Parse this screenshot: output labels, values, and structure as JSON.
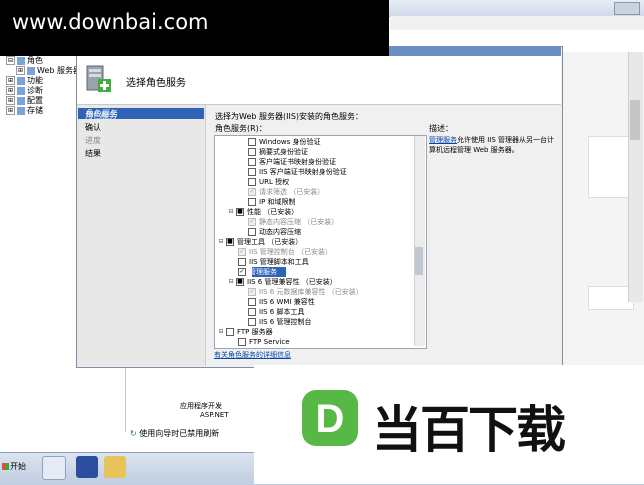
{
  "watermark": {
    "text": "www.downbai.com"
  },
  "brand": {
    "text": "当百下载",
    "logo_letter": "D",
    "colors": {
      "green": "#57b846",
      "dark": "#111111"
    }
  },
  "background": {
    "tree": [
      {
        "label": "角色",
        "expand": "⊟"
      },
      {
        "label": "Web 服务器",
        "expand": "⊞"
      },
      {
        "label": "功能",
        "expand": "⊞"
      },
      {
        "label": "诊断",
        "expand": "⊞"
      },
      {
        "label": "配置",
        "expand": "⊞"
      },
      {
        "label": "存储",
        "expand": "⊞"
      }
    ],
    "bottom_lines": [
      "应用程序开发",
      "ASP.NET"
    ],
    "status": "使用向导时已禁用刷新"
  },
  "taskbar": {
    "start_label": "开始"
  },
  "dialog": {
    "header_title": "选择角色服务",
    "steps": [
      {
        "label": "角色服务",
        "selected": true
      },
      {
        "label": "确认",
        "selected": false
      },
      {
        "label": "进度",
        "selected": false,
        "dim": true
      },
      {
        "label": "结果",
        "selected": false
      }
    ],
    "intro": "选择为Web 服务器(IIS)安装的角色服务：",
    "roles_label": "角色服务(R)：",
    "items": [
      {
        "label": "Windows 身份验证",
        "indent": 2,
        "check": "",
        "dim": false
      },
      {
        "label": "摘要式身份验证",
        "indent": 2,
        "check": "",
        "dim": false
      },
      {
        "label": "客户端证书映射身份验证",
        "indent": 2,
        "check": "",
        "dim": false
      },
      {
        "label": "IIS 客户端证书映射身份验证",
        "indent": 2,
        "check": "",
        "dim": false
      },
      {
        "label": "URL 授权",
        "indent": 2,
        "check": "",
        "dim": false
      },
      {
        "label": "请求筛选  （已安装）",
        "indent": 2,
        "check": "✓",
        "dim": true
      },
      {
        "label": "IP 和域限制",
        "indent": 2,
        "check": "",
        "dim": false
      },
      {
        "label": "性能  （已安装）",
        "indent": 1,
        "check": "■",
        "dim": false,
        "toggle": "⊟"
      },
      {
        "label": "静态内容压缩  （已安装）",
        "indent": 2,
        "check": "✓",
        "dim": true
      },
      {
        "label": "动态内容压缩",
        "indent": 2,
        "check": "",
        "dim": false
      },
      {
        "label": "管理工具  （已安装）",
        "indent": 0,
        "check": "■",
        "dim": false,
        "toggle": "⊟"
      },
      {
        "label": "IIS 管理控制台  （已安装）",
        "indent": 1,
        "check": "✓",
        "dim": true
      },
      {
        "label": "IIS 管理脚本和工具",
        "indent": 1,
        "check": "",
        "dim": false
      },
      {
        "label": "管理服务",
        "indent": 1,
        "check": "✓",
        "dim": false,
        "selected": true
      },
      {
        "label": "IIS 6 管理兼容性  （已安装）",
        "indent": 1,
        "check": "■",
        "dim": false,
        "toggle": "⊟"
      },
      {
        "label": "IIS 6 元数据库兼容性  （已安装）",
        "indent": 2,
        "check": "✓",
        "dim": true
      },
      {
        "label": "IIS 6 WMI 兼容性",
        "indent": 2,
        "check": "",
        "dim": false
      },
      {
        "label": "IIS 6 脚本工具",
        "indent": 2,
        "check": "",
        "dim": false
      },
      {
        "label": "IIS 6 管理控制台",
        "indent": 2,
        "check": "",
        "dim": false
      },
      {
        "label": "FTP 服务器",
        "indent": 0,
        "check": "",
        "dim": false,
        "toggle": "⊟"
      },
      {
        "label": "FTP Service",
        "indent": 1,
        "check": "",
        "dim": false
      }
    ],
    "more_link": "有关角色服务的详细信息",
    "description": {
      "heading": "描述：",
      "link": "管理服务",
      "text": "允许使用 IIS 管理器从另一台计算机远程管理 Web 服务器。"
    }
  }
}
